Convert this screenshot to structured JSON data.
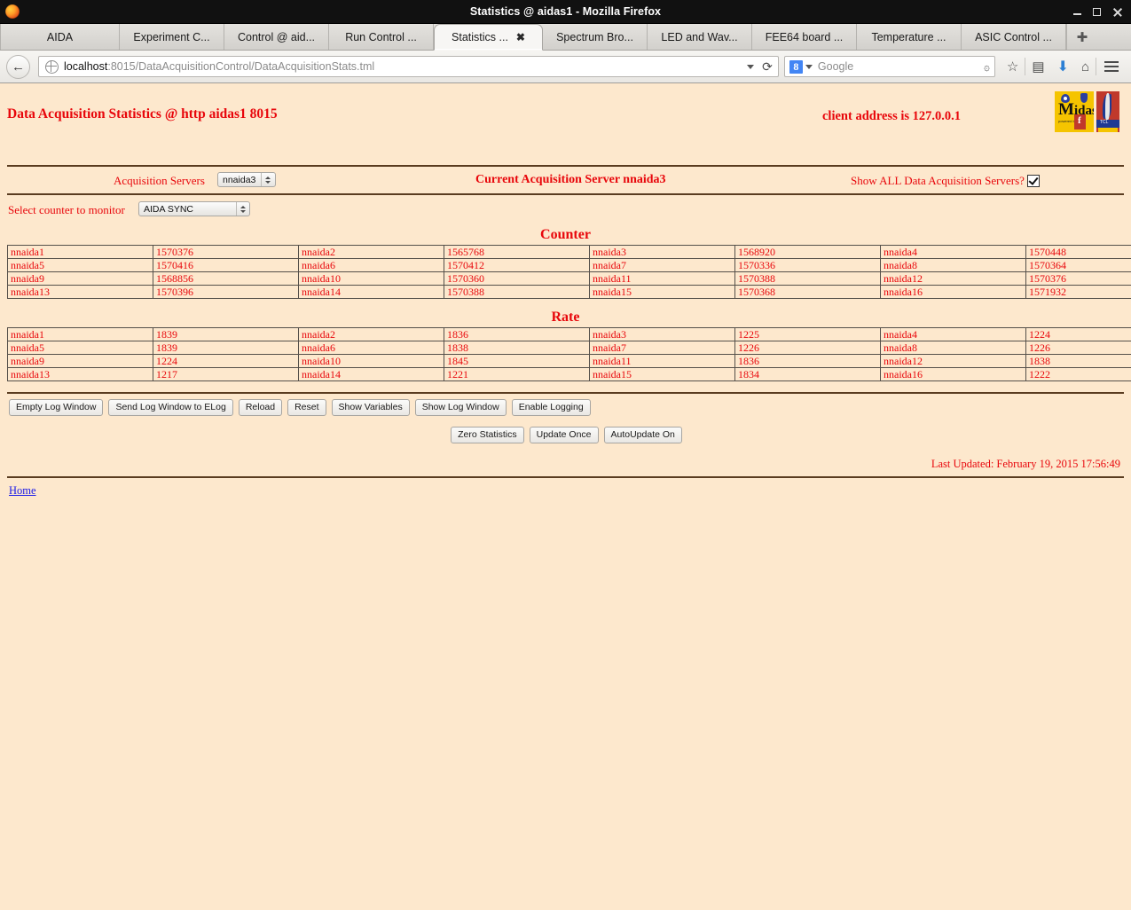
{
  "window": {
    "title": "Statistics @ aidas1 - Mozilla Firefox",
    "minimize_label": "–",
    "maximize_label": "□",
    "close_label": "✕"
  },
  "tabs": [
    {
      "label": "AIDA",
      "active": false
    },
    {
      "label": "Experiment C...",
      "active": false
    },
    {
      "label": "Control @ aid...",
      "active": false
    },
    {
      "label": "Run Control ...",
      "active": false
    },
    {
      "label": "Statistics ...",
      "active": true,
      "close_label": "✖"
    },
    {
      "label": "Spectrum Bro...",
      "active": false
    },
    {
      "label": "LED and Wav...",
      "active": false
    },
    {
      "label": "FEE64 board ...",
      "active": false
    },
    {
      "label": "Temperature ...",
      "active": false
    },
    {
      "label": "ASIC Control ...",
      "active": false
    }
  ],
  "newtab_label": "✚",
  "toolbar": {
    "back_label": "←",
    "url_host": "localhost",
    "url_rest": ":8015/DataAcquisitionControl/DataAcquisitionStats.tml",
    "dropdown_marker": "▾",
    "reload_label": "⟳",
    "search_engine_badge": "8",
    "search_placeholder": "Google",
    "search_go_label": "۞",
    "bookmark_star_label": "☆",
    "reader_label": "▤",
    "download_label": "⬇",
    "home_label": "⌂"
  },
  "page": {
    "title": "Data Acquisition Statistics @ http aidas1 8015",
    "client_address": "client address is 127.0.0.1",
    "logo_midas_text_m": "M",
    "logo_midas_text_rest": "idas",
    "logo_midas_subtext": "powered by",
    "logo_midas_f": "f",
    "logo_tcl_text": "TCL",
    "acquisition_servers_label": "Acquisition Servers",
    "acquisition_servers_value": "nnaida3",
    "current_server_label": "Current Acquisition Server nnaida3",
    "show_all_label": "Show ALL Data Acquisition Servers?",
    "show_all_checked": true,
    "counter_select_label": "Select counter to monitor",
    "counter_select_value": "AIDA SYNC",
    "counter_section_title": "Counter",
    "rate_section_title": "Rate",
    "last_updated": "Last Updated: February 19, 2015 17:56:49",
    "home_link": "Home"
  },
  "counter_table": [
    [
      [
        "nnaida1",
        "1570376"
      ],
      [
        "nnaida2",
        "1565768"
      ],
      [
        "nnaida3",
        "1568920"
      ],
      [
        "nnaida4",
        "1570448"
      ]
    ],
    [
      [
        "nnaida5",
        "1570416"
      ],
      [
        "nnaida6",
        "1570412"
      ],
      [
        "nnaida7",
        "1570336"
      ],
      [
        "nnaida8",
        "1570364"
      ]
    ],
    [
      [
        "nnaida9",
        "1568856"
      ],
      [
        "nnaida10",
        "1570360"
      ],
      [
        "nnaida11",
        "1570388"
      ],
      [
        "nnaida12",
        "1570376"
      ]
    ],
    [
      [
        "nnaida13",
        "1570396"
      ],
      [
        "nnaida14",
        "1570388"
      ],
      [
        "nnaida15",
        "1570368"
      ],
      [
        "nnaida16",
        "1571932"
      ]
    ]
  ],
  "rate_table": [
    [
      [
        "nnaida1",
        "1839"
      ],
      [
        "nnaida2",
        "1836"
      ],
      [
        "nnaida3",
        "1225"
      ],
      [
        "nnaida4",
        "1224"
      ]
    ],
    [
      [
        "nnaida5",
        "1839"
      ],
      [
        "nnaida6",
        "1838"
      ],
      [
        "nnaida7",
        "1226"
      ],
      [
        "nnaida8",
        "1226"
      ]
    ],
    [
      [
        "nnaida9",
        "1224"
      ],
      [
        "nnaida10",
        "1845"
      ],
      [
        "nnaida11",
        "1836"
      ],
      [
        "nnaida12",
        "1838"
      ]
    ],
    [
      [
        "nnaida13",
        "1217"
      ],
      [
        "nnaida14",
        "1221"
      ],
      [
        "nnaida15",
        "1834"
      ],
      [
        "nnaida16",
        "1222"
      ]
    ]
  ],
  "buttons_row1": [
    "Empty Log Window",
    "Send Log Window to ELog",
    "Reload",
    "Reset",
    "Show Variables",
    "Show Log Window",
    "Enable Logging"
  ],
  "buttons_row2": [
    "Zero Statistics",
    "Update Once",
    "AutoUpdate On"
  ],
  "colors": {
    "page_background": "#fde8cd",
    "text_red": "#e8060b",
    "link_blue": "#1a1ae8",
    "rule": "#5a3c20"
  }
}
